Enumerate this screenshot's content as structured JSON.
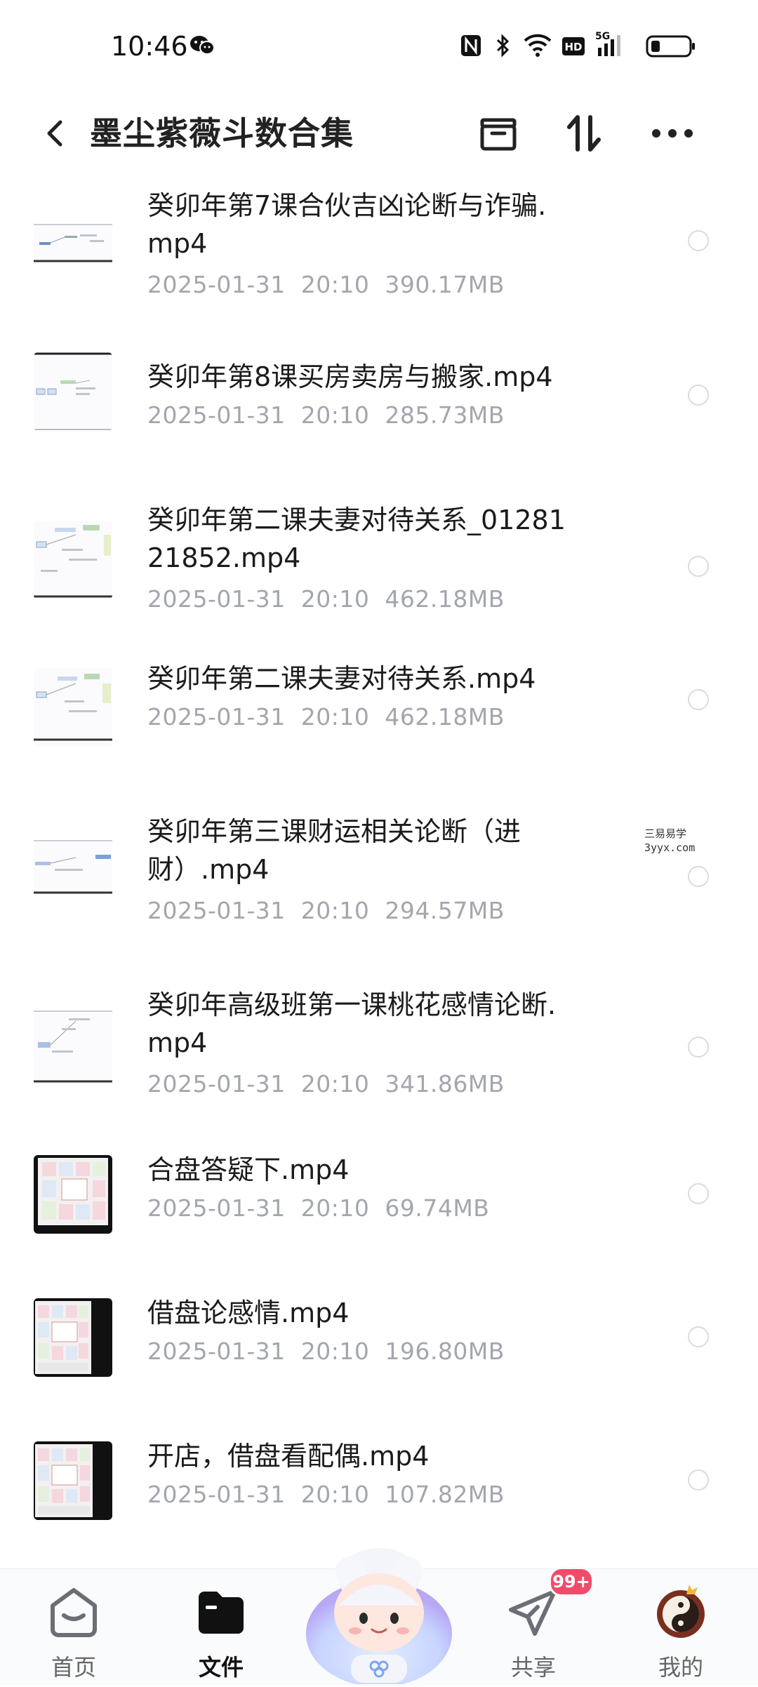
{
  "status_bar": {
    "time": "10:46",
    "network": "5G",
    "hd_label": "HD"
  },
  "header": {
    "title": "墨尘紫薇斗数合集"
  },
  "files": [
    {
      "name": "癸卯年第7课合伙吉凶论断与诈骗.mp4",
      "date": "2025-01-31",
      "time": "20:10",
      "size": "390.17MB"
    },
    {
      "name": "癸卯年第8课买房卖房与搬家.mp4",
      "date": "2025-01-31",
      "time": "20:10",
      "size": "285.73MB"
    },
    {
      "name": "癸卯年第二课夫妻对待关系_0128121852.mp4",
      "date": "2025-01-31",
      "time": "20:10",
      "size": "462.18MB"
    },
    {
      "name": "癸卯年第二课夫妻对待关系.mp4",
      "date": "2025-01-31",
      "time": "20:10",
      "size": "462.18MB"
    },
    {
      "name": "癸卯年第三课财运相关论断（进财）.mp4",
      "date": "2025-01-31",
      "time": "20:10",
      "size": "294.57MB"
    },
    {
      "name": "癸卯年高级班第一课桃花感情论断.mp4",
      "date": "2025-01-31",
      "time": "20:10",
      "size": "341.86MB"
    },
    {
      "name": "合盘答疑下.mp4",
      "date": "2025-01-31",
      "time": "20:10",
      "size": "69.74MB"
    },
    {
      "name": "借盘论感情.mp4",
      "date": "2025-01-31",
      "time": "20:10",
      "size": "196.80MB"
    },
    {
      "name": "开店，借盘看配偶.mp4",
      "date": "2025-01-31",
      "time": "20:10",
      "size": "107.82MB"
    }
  ],
  "watermark": {
    "line1": "三易易学",
    "line2": "3yyx.com"
  },
  "bottom_nav": {
    "home": "首页",
    "files": "文件",
    "share": "共享",
    "mine": "我的",
    "share_badge": "99+"
  },
  "colors": {
    "accent": "#111111",
    "meta": "#a3a6ad",
    "badge": "#f24b6a"
  },
  "icons": [
    "back-arrow-icon",
    "archive-icon",
    "sort-icon",
    "more-icon",
    "home-icon",
    "folder-icon",
    "paper-plane-icon",
    "yin-yang-avatar-icon"
  ]
}
